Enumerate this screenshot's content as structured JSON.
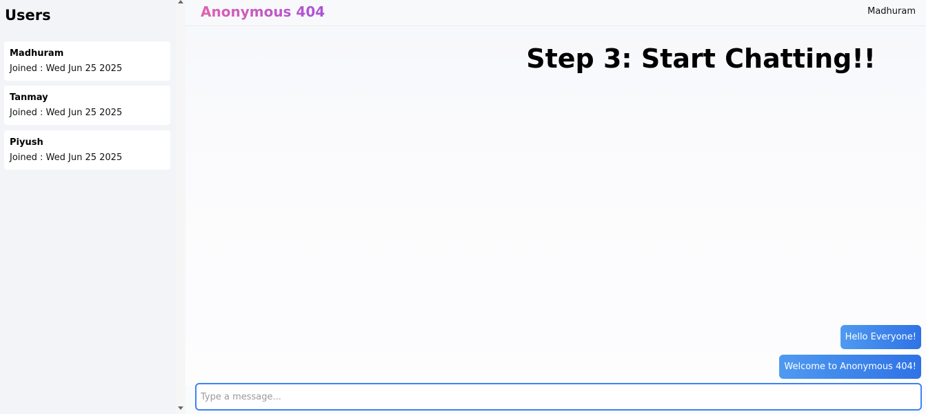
{
  "sidebar": {
    "title": "Users",
    "users": [
      {
        "name": "Madhuram",
        "joined": "Joined : Wed Jun 25 2025"
      },
      {
        "name": "Tanmay",
        "joined": "Joined : Wed Jun 25 2025"
      },
      {
        "name": "Piyush",
        "joined": "Joined : Wed Jun 25 2025"
      }
    ]
  },
  "header": {
    "brand": "Anonymous 404",
    "current_user": "Madhuram"
  },
  "hero": {
    "title": "Step 3: Start Chatting!!"
  },
  "messages": [
    {
      "text": "Hello Everyone!"
    },
    {
      "text": "Welcome to Anonymous 404!"
    }
  ],
  "composer": {
    "placeholder": "Type a message...",
    "value": ""
  },
  "colors": {
    "brand_gradient_start": "#e060b0",
    "brand_gradient_end": "#a855d6",
    "bubble_start": "#4f9af0",
    "bubble_end": "#2f72e6",
    "input_border": "#3b82f6"
  }
}
